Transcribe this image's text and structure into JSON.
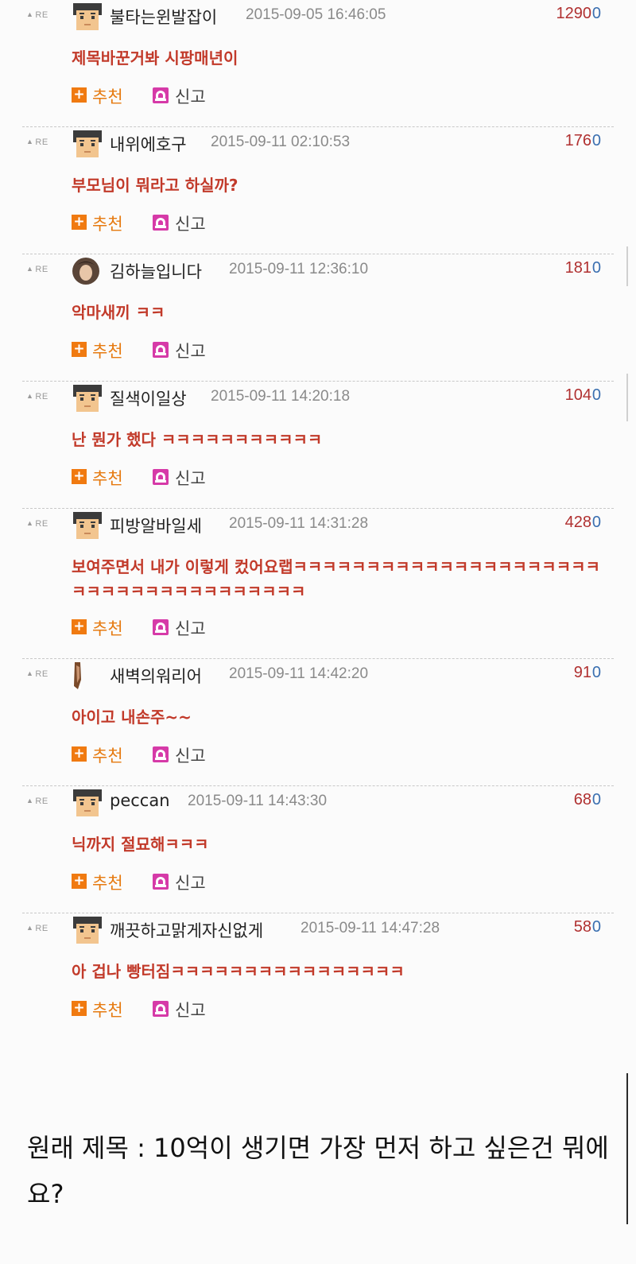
{
  "re_label": "RE",
  "recommend_label": "추천",
  "report_label": "신고",
  "comments": [
    {
      "nick": "불타는윈발잡이",
      "date": "2015-09-05 16:46:05",
      "score": "1290",
      "zero": "0",
      "text": "제목바꾼거봐 시팡매년이",
      "avatar": "pixel-face"
    },
    {
      "nick": "내위에호구",
      "date": "2015-09-11 02:10:53",
      "score": "176",
      "zero": "0",
      "text": "부모님이 뭐라고 하실까?",
      "avatar": "pixel-face"
    },
    {
      "nick": "김하늘입니다",
      "date": "2015-09-11 12:36:10",
      "score": "181",
      "zero": "0",
      "text": "악마새끼 ㅋㅋ",
      "avatar": "photo"
    },
    {
      "nick": "질색이일상",
      "date": "2015-09-11 14:20:18",
      "score": "104",
      "zero": "0",
      "text": "난 뭔가 했다 ㅋㅋㅋㅋㅋㅋㅋㅋㅋㅋㅋ",
      "avatar": "pixel-face"
    },
    {
      "nick": "피방알바일세",
      "date": "2015-09-11 14:31:28",
      "score": "428",
      "zero": "0",
      "text": "보여주면서 내가 이렇게 컸어요랩ㅋㅋㅋㅋㅋㅋㅋㅋㅋㅋㅋㅋㅋㅋㅋㅋㅋㅋㅋㅋㅋㅋㅋㅋㅋㅋㅋㅋㅋㅋㅋㅋㅋㅋㅋㅋㅋ",
      "avatar": "pixel-face"
    },
    {
      "nick": "새벽의워리어",
      "date": "2015-09-11 14:42:20",
      "score": "91",
      "zero": "0",
      "text": "아이고 내손주~~",
      "avatar": "photo-thin"
    },
    {
      "nick": "peccan",
      "date": "2015-09-11 14:43:30",
      "score": "68",
      "zero": "0",
      "text": "닉까지 절묘해ㅋㅋㅋ",
      "avatar": "pixel-face"
    },
    {
      "nick": "깨끗하고맑게자신없게",
      "date": "2015-09-11 14:47:28",
      "score": "58",
      "zero": "0",
      "text": "아 겁나 빵터짐ㅋㅋㅋㅋㅋㅋㅋㅋㅋㅋㅋㅋㅋㅋㅋㅋ",
      "avatar": "pixel-face"
    }
  ],
  "caption": "원래 제목 : 10억이 생기면 가장 먼저 하고 싶은건 뭐에요?"
}
